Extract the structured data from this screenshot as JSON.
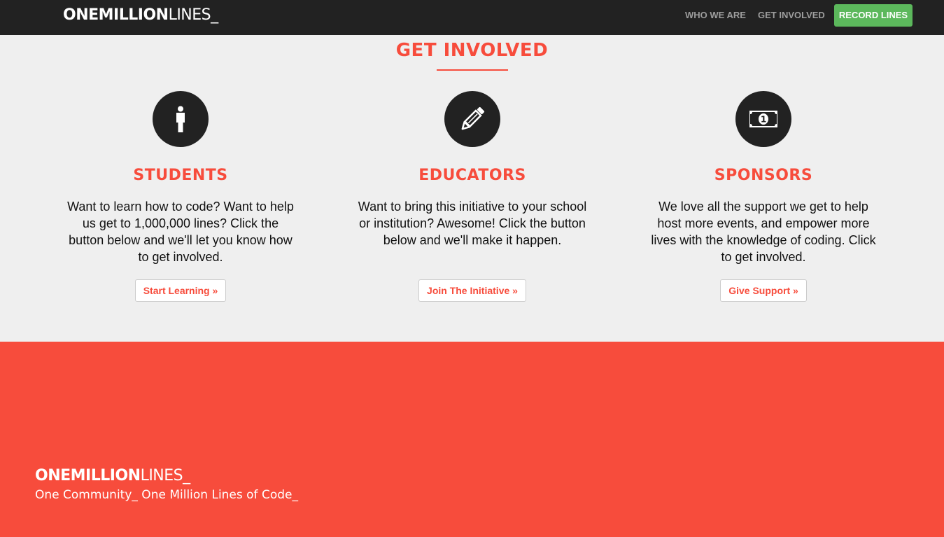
{
  "navbar": {
    "brand_bold": "ONEMILLION",
    "brand_light": "LINES_",
    "links": [
      {
        "label": "WHO WE ARE"
      },
      {
        "label": "GET INVOLVED"
      }
    ],
    "cta_label": "RECORD LINES",
    "cta_color": "#5cb85c",
    "background": "#222222"
  },
  "section": {
    "title": "GET INVOLVED",
    "accent_color": "#f74c3c",
    "columns": [
      {
        "icon": "student-icon",
        "heading": "STUDENTS",
        "text": "Want to learn how to code? Want to help us get to 1,000,000 lines? Click the button below and we'll let you know how to get involved.",
        "button": "Start Learning »"
      },
      {
        "icon": "pencil-icon",
        "heading": "EDUCATORS",
        "text": "Want to bring this initiative to your school or institution? Awesome! Click the button below and we'll make it happen.",
        "button": "Join The Initiative »"
      },
      {
        "icon": "money-icon",
        "heading": "SPONSORS",
        "text": "We love all the support we get to help host more events, and empower more lives with the knowledge of coding. Click to get involved.",
        "button": "Give Support »"
      }
    ]
  },
  "footer": {
    "brand_bold": "ONEMILLION",
    "brand_light": "LINES_",
    "tagline": "One Community_ One Million Lines of Code_",
    "background": "#f74c3c"
  }
}
